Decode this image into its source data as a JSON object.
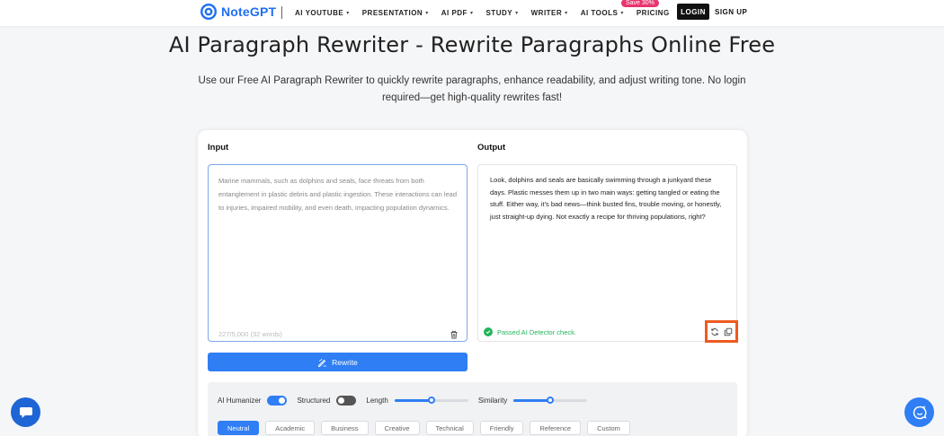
{
  "header": {
    "logo_text": "NoteGPT",
    "nav": [
      {
        "label": "AI YOUTUBE",
        "caret": true
      },
      {
        "label": "PRESENTATION",
        "caret": true
      },
      {
        "label": "AI PDF",
        "caret": true
      },
      {
        "label": "STUDY",
        "caret": true
      },
      {
        "label": "WRITER",
        "caret": true
      },
      {
        "label": "AI TOOLS",
        "caret": true
      },
      {
        "label": "PRICING",
        "caret": false
      }
    ],
    "save_badge": "Save 30%",
    "login_label": "LOGIN",
    "signup_label": "SIGN UP"
  },
  "page": {
    "title": "AI Paragraph Rewriter - Rewrite Paragraphs Online Free",
    "subtitle": "Use our Free AI Paragraph Rewriter to quickly rewrite paragraphs, enhance readability, and adjust writing tone. No login required—get high-quality rewrites fast!"
  },
  "editor": {
    "input_label": "Input",
    "output_label": "Output",
    "input_text": "Marine mammals, such as dolphins and seals, face threats from both entanglement in plastic debris and plastic ingestion. These interactions can lead to injuries, impaired mobility, and even death, impacting population dynamics.",
    "char_count": "227/5,000 (32 words)",
    "output_text": "Look, dolphins and seals are basically swimming through a junkyard these days. Plastic messes them up in two main ways: getting tangled or eating the stuff. Either way, it's bad news—think busted fins, trouble moving, or honestly, just straight-up dying. Not exactly a recipe for thriving populations, right?",
    "passed_text": "Passed AI Detector check.",
    "rewrite_label": "Rewrite"
  },
  "controls": {
    "humanizer_label": "AI Humanizer",
    "humanizer_on": true,
    "structured_label": "Structured",
    "structured_on": false,
    "length_label": "Length",
    "length_value": 0.5,
    "similarity_label": "Similarity",
    "similarity_value": 0.5,
    "tones": [
      "Neutral",
      "Academic",
      "Business",
      "Creative",
      "Technical",
      "Friendly",
      "Reference",
      "Custom"
    ],
    "active_tone": "Neutral"
  },
  "colors": {
    "brand": "#1f6ff0",
    "primary": "#2f7ef3",
    "success": "#22b45a",
    "badge": "#e8356d",
    "highlight": "#ee5a1f"
  }
}
